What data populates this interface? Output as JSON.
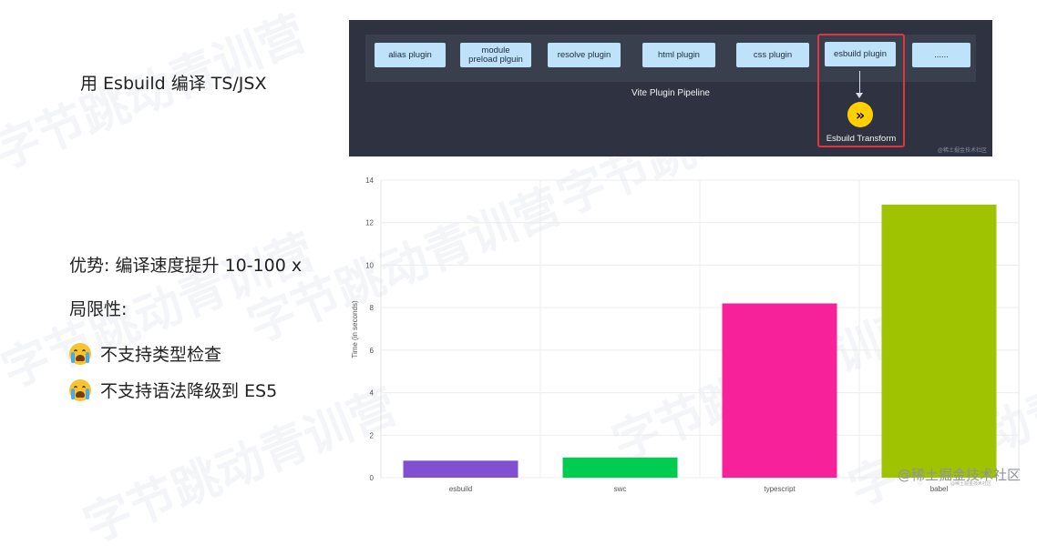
{
  "left": {
    "heading": "用 Esbuild 编译 TS/JSX",
    "advantage": "优势: 编译速度提升 10-100 x",
    "limitations_label": "局限性:",
    "limitations": [
      "不支持类型检查",
      "不支持语法降级到 ES5"
    ],
    "limitation_icon": "crying-face-emoji"
  },
  "pipeline": {
    "plugins": [
      "alias plugin",
      "module preload plguin",
      "resolve plugin",
      "html plugin",
      "css plugin",
      "esbuild plugin",
      "......"
    ],
    "highlighted": "esbuild plugin",
    "title": "Vite Plugin Pipeline",
    "transform_label": "Esbuild Transform",
    "logo_glyph": "»",
    "credit": "@稀土掘金技术社区",
    "colors": {
      "background": "#2f3341",
      "plugin": "#bfe2fb",
      "highlight": "#e0353a"
    }
  },
  "chart_data": {
    "type": "bar",
    "categories": [
      "esbuild",
      "swc",
      "typescript",
      "babel"
    ],
    "values": [
      0.8,
      0.95,
      8.2,
      12.85
    ],
    "colors": [
      "#8150d1",
      "#00cc4f",
      "#f7219a",
      "#9fc300"
    ],
    "ylabel": "Time (in seconds)",
    "xlabel": "",
    "ylim": [
      0,
      14
    ],
    "yticks": [
      0,
      2,
      4,
      6,
      8,
      10,
      12,
      14
    ],
    "grid": true,
    "legend": "none"
  },
  "watermark": {
    "text": "字节跳动青训营",
    "footer": "@稀土掘金技术社区",
    "footer_sub": "@稀土掘金技术社区"
  }
}
